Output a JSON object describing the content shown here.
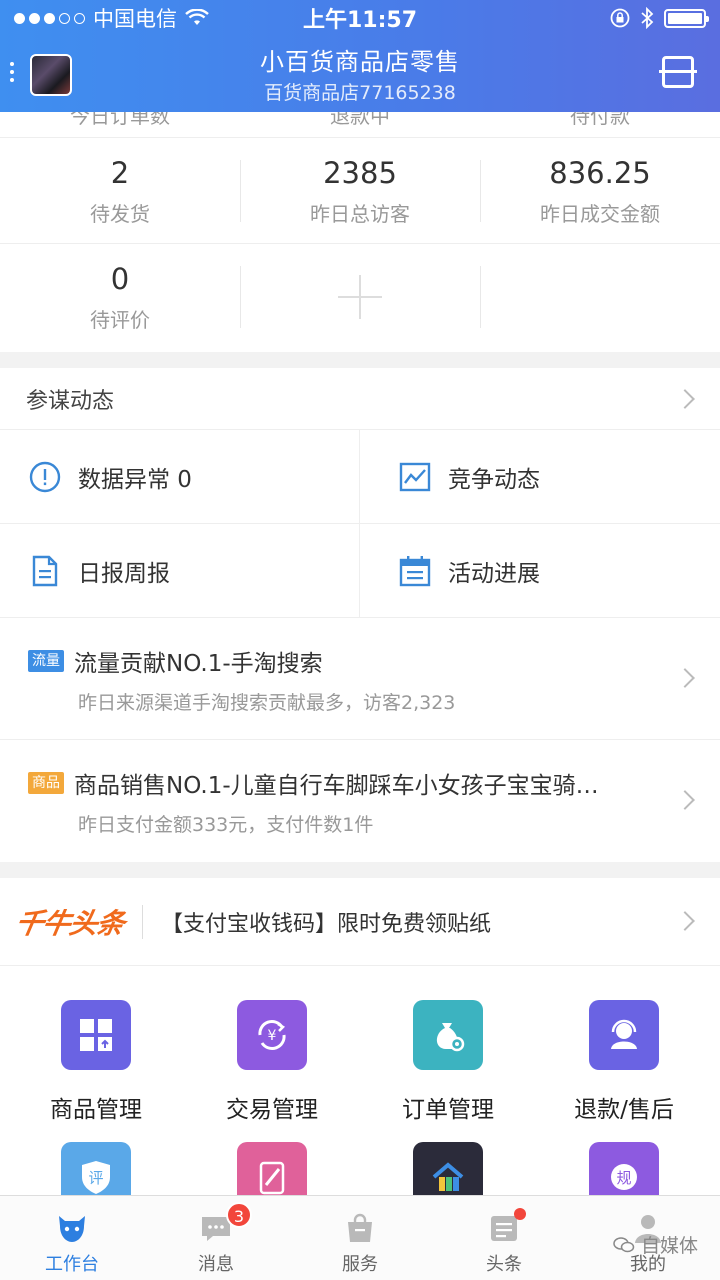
{
  "status_bar": {
    "carrier": "中国电信",
    "time": "上午11:57"
  },
  "header": {
    "title": "小百货商品店零售",
    "subtitle": "百货商品店77165238"
  },
  "stats": {
    "cut_labels": [
      "今日订单数",
      "退款中",
      "待付款"
    ],
    "row1": [
      {
        "value": "2",
        "label": "待发货"
      },
      {
        "value": "2385",
        "label": "昨日总访客"
      },
      {
        "value": "836.25",
        "label": "昨日成交金额"
      }
    ],
    "row2": [
      {
        "value": "0",
        "label": "待评价"
      }
    ]
  },
  "advisor": {
    "title": "参谋动态",
    "cells": [
      {
        "label": "数据异常 0",
        "icon": "alert-icon"
      },
      {
        "label": "竞争动态",
        "icon": "trend-chart-icon"
      },
      {
        "label": "日报周报",
        "icon": "document-icon"
      },
      {
        "label": "活动进展",
        "icon": "calendar-icon"
      }
    ],
    "news": [
      {
        "tag": "流量",
        "title": "流量贡献NO.1-手淘搜索",
        "sub": "昨日来源渠道手淘搜索贡献最多，访客2,323"
      },
      {
        "tag": "商品",
        "title": "商品销售NO.1-儿童自行车脚踩车小女孩子宝宝骑…",
        "sub": "昨日支付金额333元，支付件数1件"
      }
    ]
  },
  "headline": {
    "logo": "千牛头条",
    "text": "【支付宝收钱码】限时免费领贴纸"
  },
  "apps": [
    {
      "label": "商品管理",
      "color": "#6a63e3",
      "icon": "product-grid-icon"
    },
    {
      "label": "交易管理",
      "color": "#8d5ae0",
      "icon": "yuan-exchange-icon"
    },
    {
      "label": "订单管理",
      "color": "#3cb3c0",
      "icon": "money-bag-icon"
    },
    {
      "label": "退款/售后",
      "color": "#6a63e3",
      "icon": "customer-service-icon"
    },
    {
      "label": "",
      "color": "#5aa8e8",
      "icon": "review-shield-icon",
      "text": "评"
    },
    {
      "label": "",
      "color": "#e0619a",
      "icon": "tablet-brush-icon"
    },
    {
      "label": "",
      "color": "#2b2b3a",
      "icon": "store-house-icon"
    },
    {
      "label": "",
      "color": "#8d5ae0",
      "icon": "rule-icon",
      "text": "规"
    }
  ],
  "tabbar": {
    "tabs": [
      {
        "label": "工作台",
        "active": true
      },
      {
        "label": "消息",
        "badge": "3"
      },
      {
        "label": "服务"
      },
      {
        "label": "头条",
        "dot": true
      },
      {
        "label": "我的"
      }
    ]
  },
  "watermark": "自媒体"
}
